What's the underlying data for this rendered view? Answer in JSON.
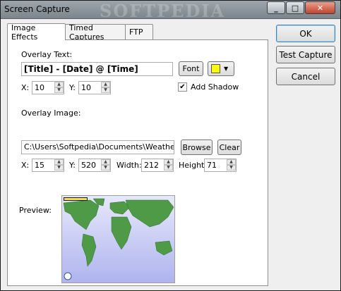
{
  "window": {
    "title": "Screen Capture",
    "watermark": "SOFTPEDIA"
  },
  "titlebar_buttons": {
    "minimize": "_",
    "maximize": "□",
    "close": "✕"
  },
  "tabs": [
    {
      "label": "Image Effects",
      "active": true
    },
    {
      "label": "Timed Captures",
      "active": false
    },
    {
      "label": "FTP",
      "active": false
    }
  ],
  "overlay_text": {
    "label": "Overlay Text:",
    "value": "[Title] - [Date] @ [Time]",
    "font_button": "Font",
    "color": "#ffff00",
    "x_label": "X:",
    "x_value": "10",
    "y_label": "Y:",
    "y_value": "10",
    "add_shadow_label": "Add Shadow",
    "add_shadow_checked": true
  },
  "overlay_image": {
    "label": "Overlay Image:",
    "path": "C:\\Users\\Softpedia\\Documents\\Weather ...",
    "browse_button": "Browse",
    "clear_button": "Clear",
    "x_label": "X:",
    "x_value": "15",
    "y_label": "Y:",
    "y_value": "520",
    "width_label": "Width:",
    "width_value": "212",
    "height_label": "Height:",
    "height_value": "71"
  },
  "preview": {
    "label": "Preview:"
  },
  "side_buttons": {
    "ok": "OK",
    "test": "Test Capture",
    "cancel": "Cancel"
  },
  "colors": {
    "titlebar": "#8a9298",
    "panel": "#ffffff",
    "ocean": "#c7cbf3",
    "land": "#4f9a47"
  }
}
